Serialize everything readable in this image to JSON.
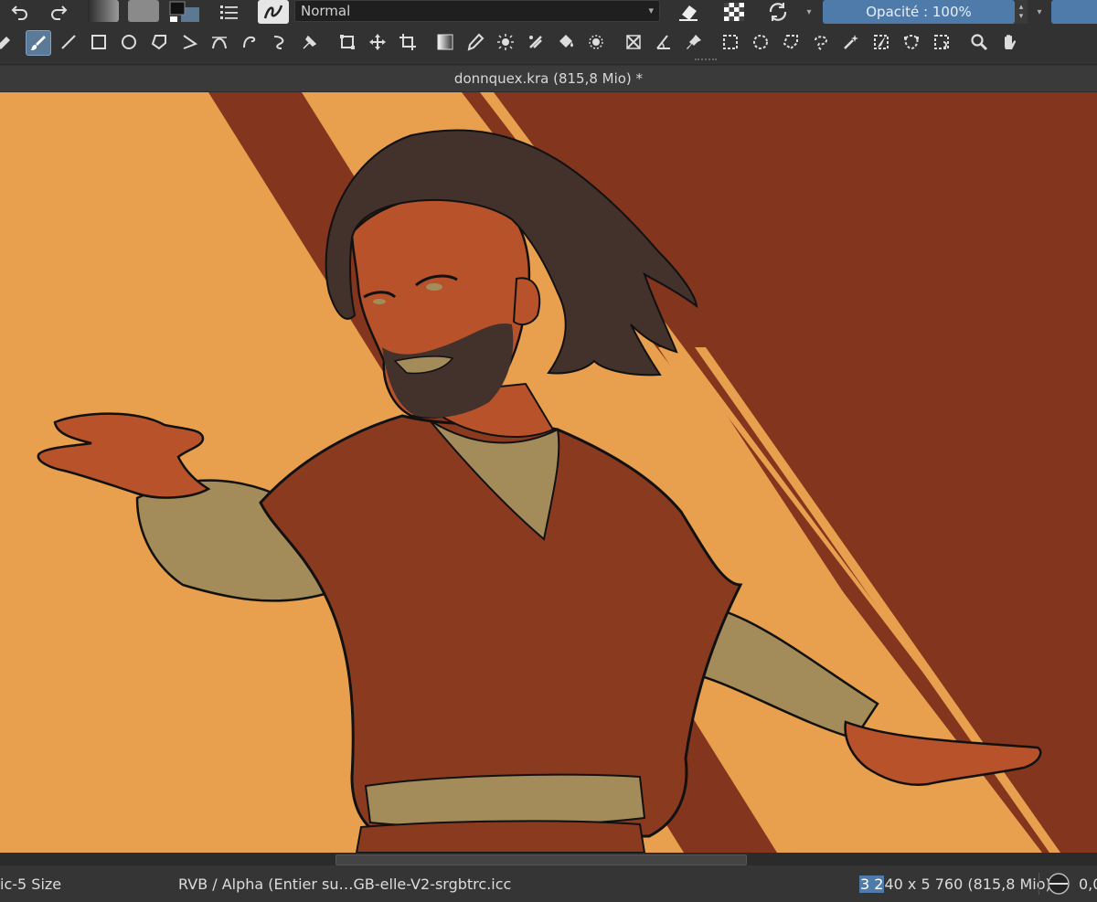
{
  "top": {
    "blend_mode": "Normal",
    "opacity": "Opacité : 100%"
  },
  "toolbar": {
    "tools": [
      "transform-partial-icon",
      "freehand-brush-icon",
      "line-icon",
      "rectangle-icon",
      "ellipse-icon",
      "polygon-icon",
      "polyline-icon",
      "bezier-curve-icon",
      "freehand-path-icon",
      "dynamic-brush-icon",
      "multibrush-icon",
      "crop-frame-icon",
      "move-icon",
      "crop-icon",
      "gradient-icon",
      "color-picker-icon",
      "smart-patch-icon",
      "fill-icon",
      "colorize-mask-icon",
      "assistant-icon",
      "measure-icon",
      "reference-pin-icon",
      "rect-select-icon",
      "ellipse-select-icon",
      "polygon-select-icon",
      "freehand-select-icon",
      "magic-wand-icon",
      "similar-select-icon",
      "bezier-select-icon",
      "magnetic-select-icon",
      "zoom-icon",
      "pan-icon"
    ]
  },
  "document": {
    "title": "donnquex.kra (815,8 Mio) *"
  },
  "status": {
    "brush": "ic-5 Size",
    "color_profile": "RVB / Alpha (Entier su…GB-elle-V2-srgbtrc.icc",
    "dims_highlight": "3 2",
    "dims_rest": "40 x 5 760 (815,8 Mio)",
    "zoom": "0,0"
  },
  "colors": {
    "ui_bg": "#323232",
    "accent": "#4f7bab",
    "canvas_light": "#e8a04e",
    "canvas_dark": "#84351d"
  }
}
